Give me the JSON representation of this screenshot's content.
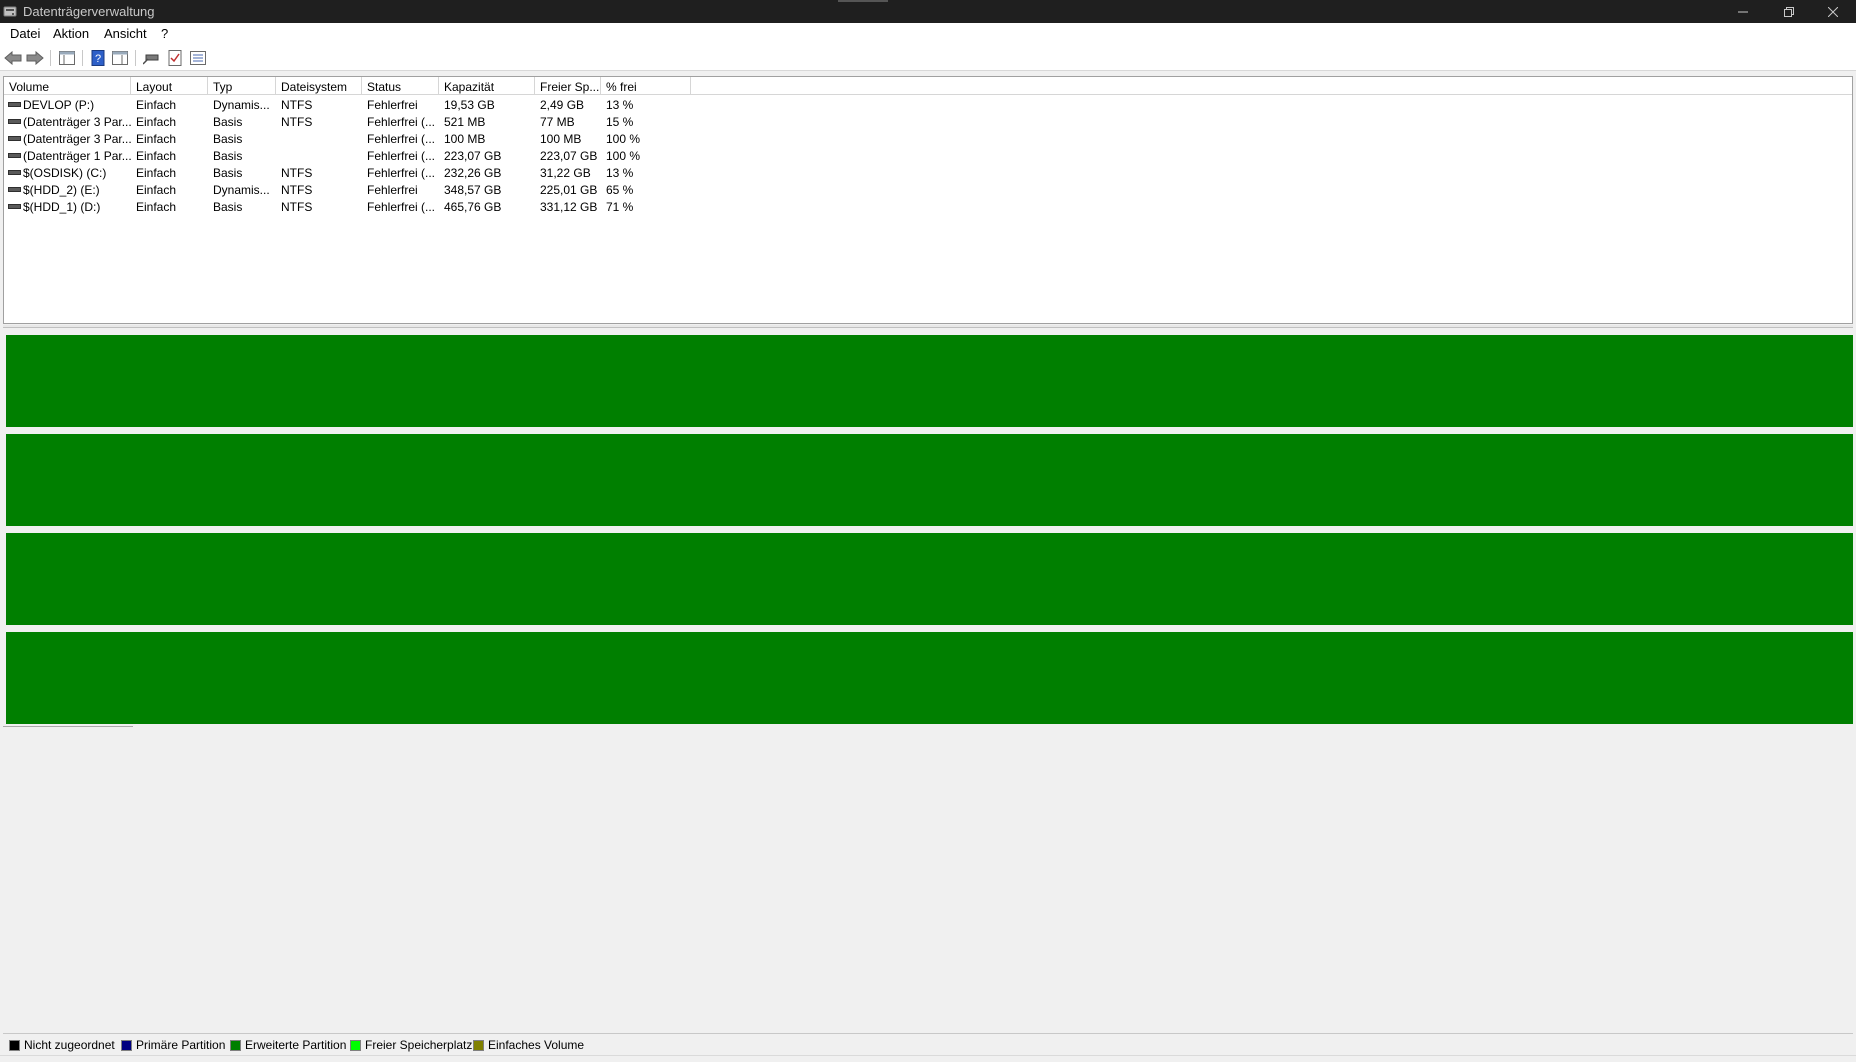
{
  "window": {
    "title": "Datenträgerverwaltung",
    "controls": [
      "minimize-icon",
      "restore-icon",
      "close-icon"
    ]
  },
  "menu": {
    "items": [
      "Datei",
      "Aktion",
      "Ansicht",
      "?"
    ]
  },
  "toolbar": {
    "buttons": [
      "back-arrow-icon",
      "forward-arrow-icon",
      "console-tree-icon",
      "help-icon",
      "properties-pane-icon",
      "connect-disk-icon",
      "check-icon",
      "list-view-icon"
    ]
  },
  "volume_list": {
    "columns": [
      "Volume",
      "Layout",
      "Typ",
      "Dateisystem",
      "Status",
      "Kapazität",
      "Freier Sp...",
      "% frei"
    ],
    "rows": [
      [
        "DEVLOP (P:)",
        "Einfach",
        "Dynamis...",
        "NTFS",
        "Fehlerfrei",
        "19,53 GB",
        "2,49 GB",
        "13 %"
      ],
      [
        "(Datenträger 3 Par...",
        "Einfach",
        "Basis",
        "NTFS",
        "Fehlerfrei (...",
        "521 MB",
        "77 MB",
        "15 %"
      ],
      [
        "(Datenträger 3 Par...",
        "Einfach",
        "Basis",
        "",
        "Fehlerfrei (...",
        "100 MB",
        "100 MB",
        "100 %"
      ],
      [
        "(Datenträger 1 Par...",
        "Einfach",
        "Basis",
        "",
        "Fehlerfrei (...",
        "223,07 GB",
        "223,07 GB",
        "100 %"
      ],
      [
        "$(OSDISK) (C:)",
        "Einfach",
        "Basis",
        "NTFS",
        "Fehlerfrei (...",
        "232,26 GB",
        "31,22 GB",
        "13 %"
      ],
      [
        "$(HDD_2) (E:)",
        "Einfach",
        "Dynamis...",
        "NTFS",
        "Fehlerfrei",
        "348,57 GB",
        "225,01 GB",
        "65 %"
      ],
      [
        "$(HDD_1) (D:)",
        "Einfach",
        "Basis",
        "NTFS",
        "Fehlerfrei (...",
        "465,76 GB",
        "331,12 GB",
        "71 %"
      ]
    ]
  },
  "disk_graphics": {
    "count": 4,
    "color": "#007f00"
  },
  "legend": {
    "items": [
      {
        "label": "Nicht zugeordnet",
        "color": "#000000"
      },
      {
        "label": "Primäre Partition",
        "color": "#000080"
      },
      {
        "label": "Erweiterte Partition",
        "color": "#007f00"
      },
      {
        "label": "Freier Speicherplatz",
        "color": "#00ff00"
      },
      {
        "label": "Einfaches Volume",
        "color": "#808000"
      }
    ]
  }
}
